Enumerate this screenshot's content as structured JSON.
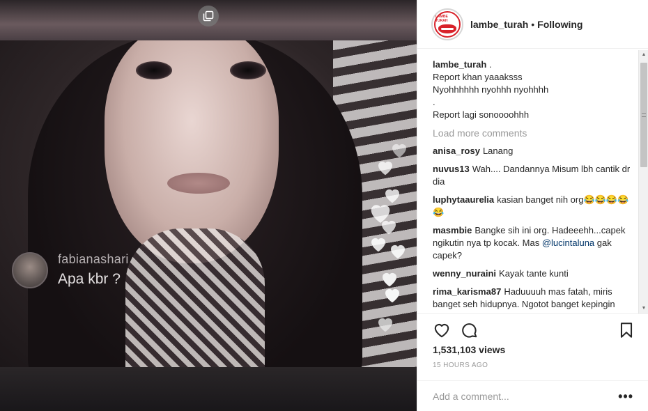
{
  "post": {
    "username": "lambe_turah",
    "separator": "•",
    "follow_status": "Following",
    "logo_text": "LAMBE TURAH",
    "caption": {
      "username": "lambe_turah",
      "lines": [
        " .",
        "Report khan yaaaksss",
        "Nyohhhhhh nyohhh nyohhhh",
        ".",
        "Report lagi sonoooohhh"
      ]
    },
    "load_more": "Load more comments",
    "comments": [
      {
        "user": "anisa_rosy",
        "text": "Lanang"
      },
      {
        "user": "nuvus13",
        "text": "Wah.... Dandannya Misum lbh cantik dr dia"
      },
      {
        "user": "luphytaaurelia",
        "text": "kasian banget nih org😂😂😂😂😂"
      },
      {
        "user": "masmbie",
        "text_before": "Bangke sih ini org. Hadeeehh...capek ngikutin nya tp kocak. Mas ",
        "mention": "@lucintaluna",
        "text_after": " gak capek?"
      },
      {
        "user": "wenny_nuraini",
        "text": "Kayak tante kunti"
      },
      {
        "user": "rima_karisma87",
        "text": "Haduuuuh mas fatah, miris banget seh hidupnya. Ngotot banget kepingin dibilang cewe tuleeen... walaupun"
      }
    ],
    "views": "1,531,103 views",
    "time": "15 HOURS AGO",
    "add_comment_placeholder": "Add a comment...",
    "more_label": "•••"
  },
  "video": {
    "live_comment_user": "fabianashari",
    "live_comment_text": "Apa kbr ?"
  },
  "icons": {
    "carousel": "carousel-icon",
    "like": "heart-icon",
    "comment": "comment-icon",
    "save": "bookmark-icon",
    "more": "more-options-icon"
  },
  "colors": {
    "brand_red": "#d8222a",
    "mention": "#003569",
    "muted": "#999999"
  }
}
